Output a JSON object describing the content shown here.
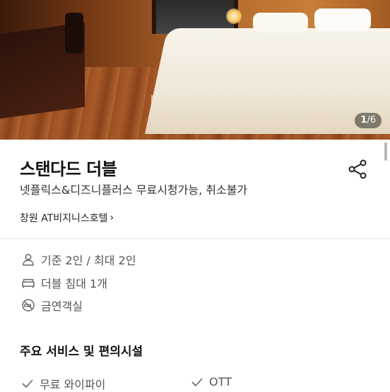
{
  "photo": {
    "counter_current": "1",
    "counter_sep": "/",
    "counter_total": "6"
  },
  "room": {
    "title": "스탠다드 더블",
    "subtitle": "넷플릭스&디즈니플러스 무료시청가능, 취소불가",
    "hotel_name": "창원 AT비지니스호텔",
    "hotel_chevron": "›"
  },
  "info": [
    {
      "icon": "person-icon",
      "text": "기준 2인 / 최대 2인"
    },
    {
      "icon": "bed-icon",
      "text": "더블 침대 1개"
    },
    {
      "icon": "no-smoking-icon",
      "text": "금연객실"
    }
  ],
  "services": {
    "title": "주요 서비스 및 편의시설",
    "items": [
      {
        "icon": "check-icon",
        "label": "무료 와이파이"
      },
      {
        "icon": "check-icon",
        "label": "OTT"
      }
    ]
  }
}
